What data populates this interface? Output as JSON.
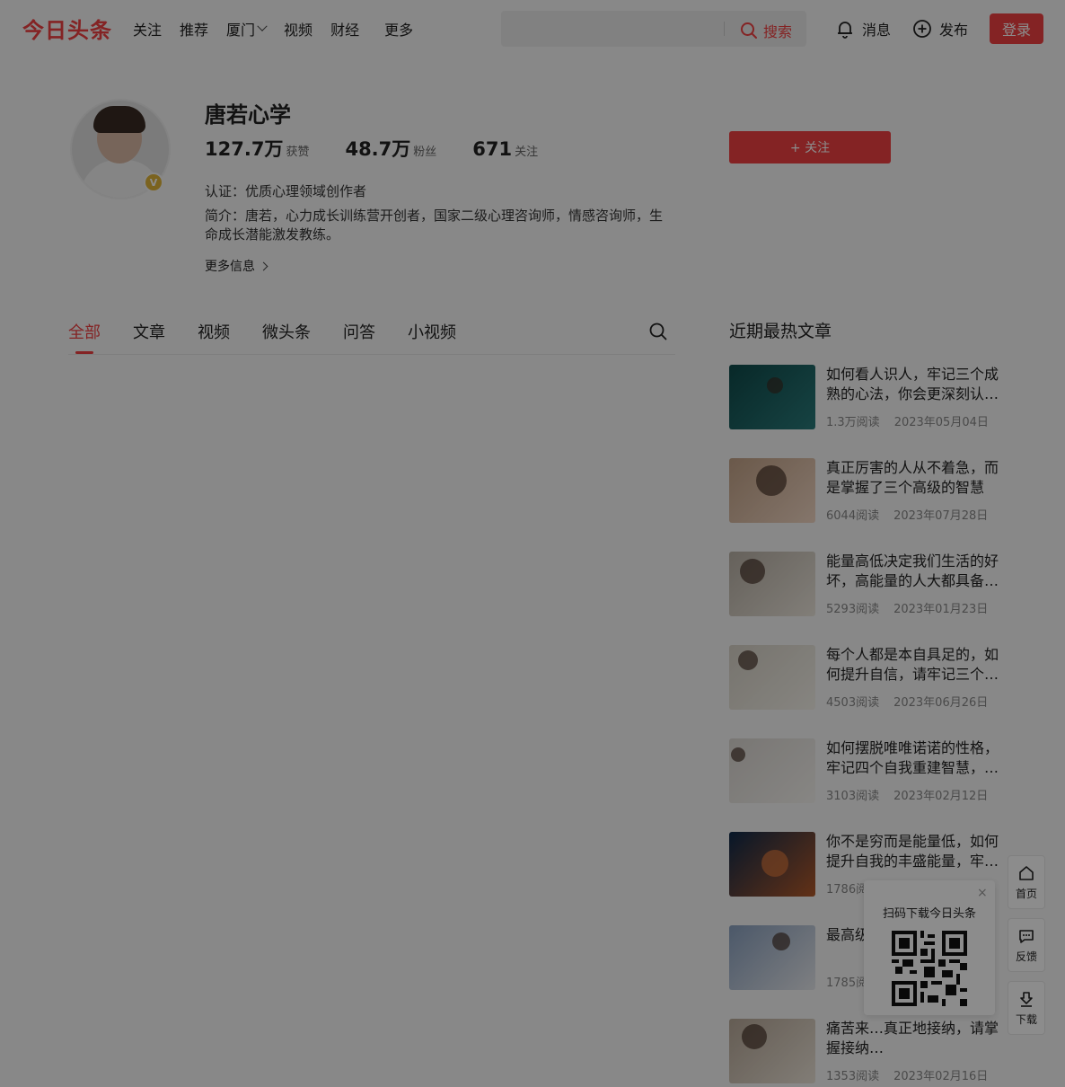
{
  "header": {
    "logo": "今日头条",
    "nav": [
      "关注",
      "推荐",
      "厦门",
      "视频",
      "财经"
    ],
    "nav_more": "更多",
    "search_placeholder": "",
    "search_button": "搜索",
    "messages": "消息",
    "publish": "发布",
    "login": "登录"
  },
  "profile": {
    "name": "唐若心学",
    "stats": [
      {
        "num": "127.7万",
        "label": "获赞"
      },
      {
        "num": "48.7万",
        "label": "粉丝"
      },
      {
        "num": "671",
        "label": "关注"
      }
    ],
    "certification": "认证：优质心理领域创作者",
    "bio": "简介：唐若，心力成长训练营开创者，国家二级心理咨询师，情感咨询师，生命成长潜能激发教练。",
    "more_info": "更多信息",
    "follow_button": "+ 关注",
    "badge": "V"
  },
  "tabs": [
    "全部",
    "文章",
    "视频",
    "微头条",
    "问答",
    "小视频"
  ],
  "sidebar": {
    "title": "近期最热文章",
    "articles": [
      {
        "title": "如何看人识人，牢记三个成熟的心法，你会更深刻认…",
        "reads": "1.3万阅读",
        "date": "2023年05月04日"
      },
      {
        "title": "真正厉害的人从不着急，而是掌握了三个高级的智慧",
        "reads": "6044阅读",
        "date": "2023年07月28日"
      },
      {
        "title": "能量高低决定我们生活的好坏，高能量的人大都具备…",
        "reads": "5293阅读",
        "date": "2023年01月23日"
      },
      {
        "title": "每个人都是本自具足的，如何提升自信，请牢记三个…",
        "reads": "4503阅读",
        "date": "2023年06月26日"
      },
      {
        "title": "如何摆脱唯唯诺诺的性格，牢记四个自我重建智慧，…",
        "reads": "3103阅读",
        "date": "2023年02月12日"
      },
      {
        "title": "你不是穷而是能量低，如何提升自我的丰盛能量，牢…",
        "reads": "1786阅读",
        "date": ""
      },
      {
        "title": "最高级…源头，…",
        "reads": "1785阅读",
        "date": ""
      },
      {
        "title": "痛苦来…真正地接纳，请掌握接纳…",
        "reads": "1353阅读",
        "date": "2023年02月16日"
      }
    ]
  },
  "float": {
    "home": "首页",
    "feedback": "反馈",
    "download": "下载"
  },
  "qr": {
    "title": "扫码下载今日头条",
    "close": "×"
  },
  "colors": {
    "brand": "#f04142",
    "background": "#f8f8f8"
  }
}
